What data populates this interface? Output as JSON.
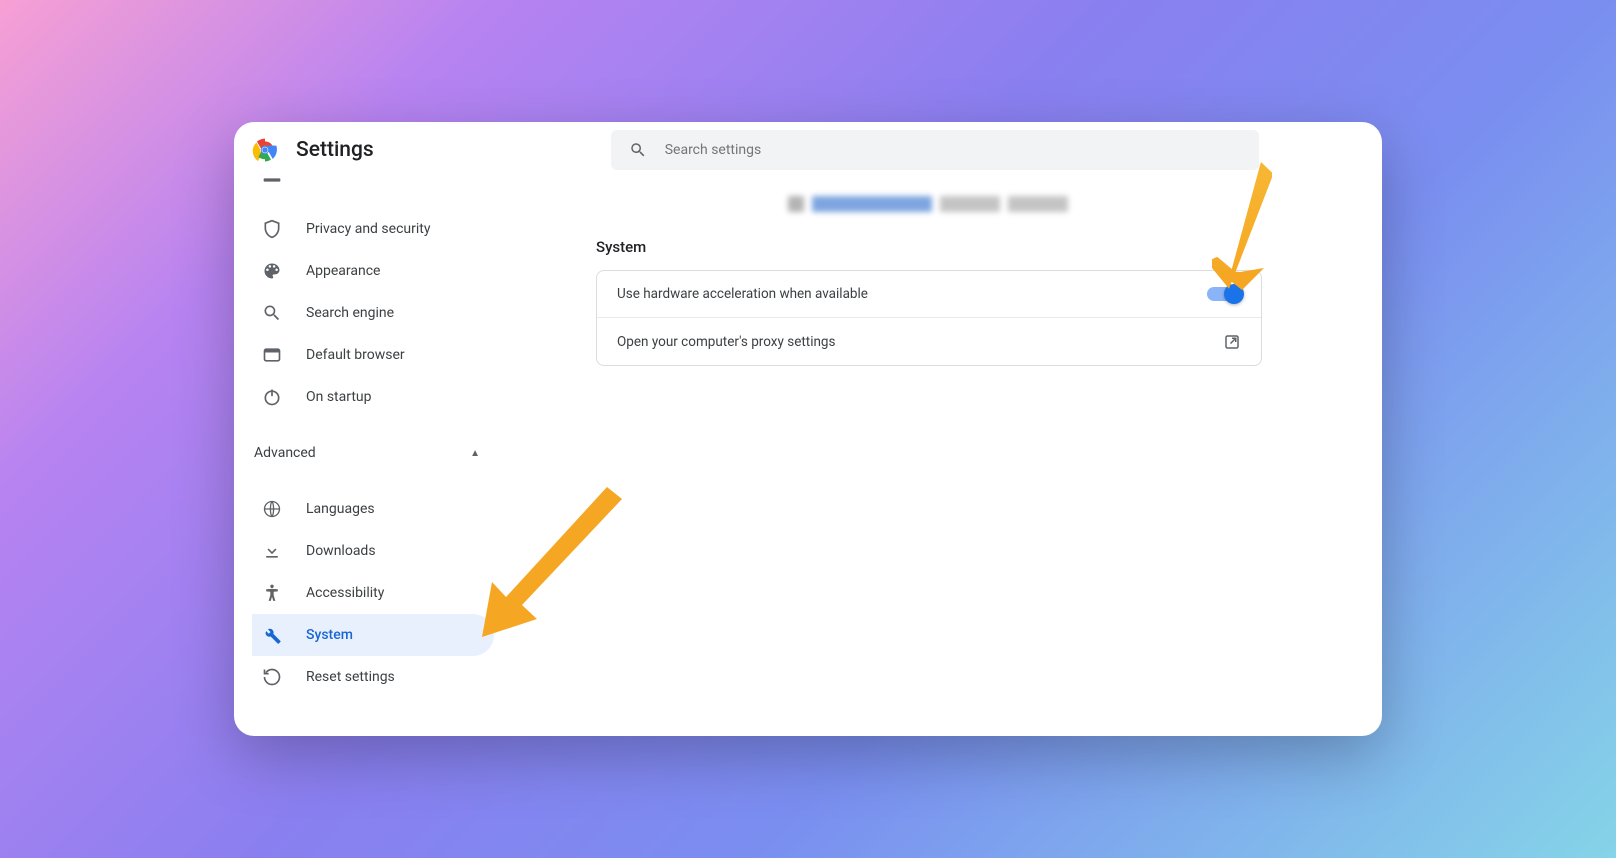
{
  "header": {
    "title": "Settings",
    "search_placeholder": "Search settings"
  },
  "sidebar": {
    "items_top": [
      {
        "id": "privacy-and-security",
        "label": "Privacy and security"
      },
      {
        "id": "appearance",
        "label": "Appearance"
      },
      {
        "id": "search-engine",
        "label": "Search engine"
      },
      {
        "id": "default-browser",
        "label": "Default browser"
      },
      {
        "id": "on-startup",
        "label": "On startup"
      }
    ],
    "section_label": "Advanced",
    "items_advanced": [
      {
        "id": "languages",
        "label": "Languages"
      },
      {
        "id": "downloads",
        "label": "Downloads"
      },
      {
        "id": "accessibility",
        "label": "Accessibility"
      },
      {
        "id": "system",
        "label": "System",
        "active": true
      },
      {
        "id": "reset-settings",
        "label": "Reset settings"
      }
    ]
  },
  "main": {
    "section_title": "System",
    "rows": [
      {
        "label": "Use hardware acceleration when available",
        "toggle": true
      },
      {
        "label": "Open your computer's proxy settings"
      }
    ]
  },
  "colors": {
    "accent": "#1a73e8",
    "arrow": "#f5a623"
  }
}
